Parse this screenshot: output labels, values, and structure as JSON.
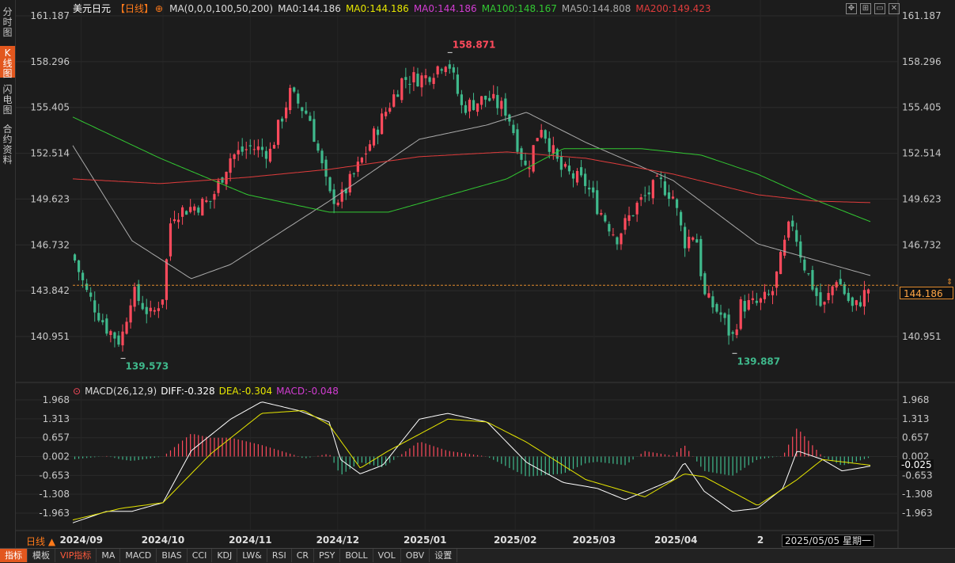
{
  "sidebar": {
    "tabs": [
      {
        "label": "分\n时\n图",
        "active": false
      },
      {
        "label": "K\n线\n图",
        "active": true
      },
      {
        "label": "闪\n电\n图",
        "active": false
      },
      {
        "label": "合\n约\n资\n料",
        "active": false
      }
    ]
  },
  "header": {
    "symbol": "美元日元",
    "period_tag": "【日线】",
    "ma_params": "MA(0,0,0,100,50,200)",
    "ma0_a": "MA0:144.186",
    "ma0_b": "MA0:144.186",
    "ma0_c": "MA0:144.186",
    "ma100": "MA100:148.167",
    "ma50": "MA50:144.808",
    "ma200": "MA200:149.423"
  },
  "macd_header": {
    "params": "MACD(26,12,9)",
    "diff": "DIFF:-0.328",
    "dea": "DEA:-0.304",
    "macd": "MACD:-0.048"
  },
  "price_tag": "144.186",
  "macd_tag": "-0.025",
  "period_button": "日线 ▲",
  "date_box": "2025/05/05 星期一",
  "bottom_tabs": [
    "指标",
    "模板",
    "VIP指标",
    "MA",
    "MACD",
    "BIAS",
    "CCI",
    "KDJ",
    "LW&",
    "RSI",
    "CR",
    "PSY",
    "BOLL",
    "VOL",
    "OBV",
    "设置"
  ],
  "colors": {
    "up": "#ff4a5c",
    "down": "#3fb98c",
    "ma50": "#aaaaaa",
    "ma100": "#32c832",
    "ma200": "#e03c3c",
    "dif": "#ffffff",
    "dea": "#e6e600",
    "accent": "#e2571e"
  },
  "chart_data": [
    {
      "type": "candlestick",
      "title": "美元日元 日线",
      "y_ticks": [
        161.187,
        158.296,
        155.405,
        152.514,
        149.623,
        146.732,
        143.842,
        140.951
      ],
      "ylim": [
        139.0,
        162.0
      ],
      "x_ticks": [
        "2024/09",
        "2024/10",
        "2024/11",
        "2024/12",
        "2025/01",
        "2025/02",
        "2025/03",
        "2025/04",
        "2025/05"
      ],
      "annotations": [
        {
          "label": "158.871",
          "type": "high"
        },
        {
          "label": "139.573",
          "type": "low"
        },
        {
          "label": "139.887",
          "type": "low"
        }
      ],
      "current_price": 144.186,
      "close_path": [
        [
          "2024/08/30",
          146.1
        ],
        [
          "2024/09/04",
          143.7
        ],
        [
          "2024/09/11",
          141.5
        ],
        [
          "2024/09/16",
          140.6
        ],
        [
          "2024/09/20",
          143.8
        ],
        [
          "2024/09/27",
          142.2
        ],
        [
          "2024/10/01",
          143.6
        ],
        [
          "2024/10/04",
          148.7
        ],
        [
          "2024/10/11",
          149.1
        ],
        [
          "2024/10/18",
          149.5
        ],
        [
          "2024/10/25",
          152.3
        ],
        [
          "2024/11/01",
          152.9
        ],
        [
          "2024/11/08",
          152.6
        ],
        [
          "2024/11/15",
          156.3
        ],
        [
          "2024/11/22",
          154.8
        ],
        [
          "2024/11/29",
          149.8
        ],
        [
          "2024/12/03",
          149.6
        ],
        [
          "2024/12/10",
          151.9
        ],
        [
          "2024/12/18",
          154.8
        ],
        [
          "2024/12/25",
          157.2
        ],
        [
          "2025/01/02",
          157.3
        ],
        [
          "2025/01/10",
          158.5
        ],
        [
          "2025/01/15",
          155.4
        ],
        [
          "2025/01/24",
          156.0
        ],
        [
          "2025/01/31",
          155.2
        ],
        [
          "2025/02/07",
          151.4
        ],
        [
          "2025/02/12",
          154.4
        ],
        [
          "2025/02/19",
          151.5
        ],
        [
          "2025/02/28",
          150.6
        ],
        [
          "2025/03/04",
          149.2
        ],
        [
          "2025/03/11",
          147.2
        ],
        [
          "2025/03/18",
          149.2
        ],
        [
          "2025/03/26",
          150.7
        ],
        [
          "2025/03/31",
          149.8
        ],
        [
          "2025/04/04",
          146.9
        ],
        [
          "2025/04/08",
          147.6
        ],
        [
          "2025/04/11",
          143.5
        ],
        [
          "2025/04/17",
          142.3
        ],
        [
          "2025/04/21",
          140.8
        ],
        [
          "2025/04/24",
          142.9
        ],
        [
          "2025/04/30",
          143.0
        ],
        [
          "2025/05/05",
          143.6
        ],
        [
          "2025/05/12",
          148.4
        ],
        [
          "2025/05/16",
          145.7
        ],
        [
          "2025/05/23",
          142.6
        ],
        [
          "2025/05/28",
          144.7
        ],
        [
          "2025/06/03",
          142.6
        ],
        [
          "2025/06/09",
          144.186
        ]
      ],
      "series": [
        {
          "name": "MA50",
          "values_path": [
            [
              "2024/08/30",
              153.0
            ],
            [
              "2024/09/20",
              147.0
            ],
            [
              "2024/10/11",
              144.6
            ],
            [
              "2024/10/25",
              145.5
            ],
            [
              "2024/11/29",
              149.5
            ],
            [
              "2024/12/31",
              153.4
            ],
            [
              "2025/01/24",
              154.3
            ],
            [
              "2025/02/07",
              155.1
            ],
            [
              "2025/02/28",
              153.2
            ],
            [
              "2025/03/31",
              150.8
            ],
            [
              "2025/04/30",
              146.8
            ],
            [
              "2025/05/28",
              145.4
            ],
            [
              "2025/06/09",
              144.8
            ]
          ]
        },
        {
          "name": "MA100",
          "values_path": [
            [
              "2024/08/30",
              154.8
            ],
            [
              "2024/09/30",
              152.2
            ],
            [
              "2024/10/31",
              149.9
            ],
            [
              "2024/11/29",
              148.8
            ],
            [
              "2024/12/20",
              148.8
            ],
            [
              "2025/01/31",
              150.9
            ],
            [
              "2025/02/20",
              152.8
            ],
            [
              "2025/03/20",
              152.8
            ],
            [
              "2025/04/10",
              152.4
            ],
            [
              "2025/04/30",
              151.2
            ],
            [
              "2025/05/20",
              149.6
            ],
            [
              "2025/06/09",
              148.2
            ]
          ]
        },
        {
          "name": "MA200",
          "values_path": [
            [
              "2024/08/30",
              150.9
            ],
            [
              "2024/09/30",
              150.6
            ],
            [
              "2024/10/31",
              151.0
            ],
            [
              "2024/11/29",
              151.5
            ],
            [
              "2024/12/31",
              152.3
            ],
            [
              "2025/01/31",
              152.6
            ],
            [
              "2025/02/28",
              152.2
            ],
            [
              "2025/03/31",
              151.2
            ],
            [
              "2025/04/30",
              149.9
            ],
            [
              "2025/05/20",
              149.5
            ],
            [
              "2025/06/09",
              149.4
            ]
          ]
        }
      ]
    },
    {
      "type": "line",
      "title": "MACD(26,12,9)",
      "y_ticks": [
        1.968,
        1.313,
        0.657,
        0.002,
        -0.653,
        -1.308,
        -1.963
      ],
      "ylim": [
        -2.4,
        2.3
      ],
      "series": [
        {
          "name": "DIFF",
          "values_path": [
            [
              "2024/08/30",
              -2.3
            ],
            [
              "2024/09/11",
              -1.9
            ],
            [
              "2024/09/20",
              -1.9
            ],
            [
              "2024/10/01",
              -1.6
            ],
            [
              "2024/10/11",
              0.2
            ],
            [
              "2024/10/25",
              1.3
            ],
            [
              "2024/11/05",
              1.9
            ],
            [
              "2024/11/18",
              1.6
            ],
            [
              "2024/11/29",
              1.2
            ],
            [
              "2024/12/03",
              -0.1
            ],
            [
              "2024/12/10",
              -0.6
            ],
            [
              "2024/12/18",
              -0.3
            ],
            [
              "2024/12/31",
              1.3
            ],
            [
              "2025/01/10",
              1.5
            ],
            [
              "2025/01/24",
              1.2
            ],
            [
              "2025/02/07",
              -0.2
            ],
            [
              "2025/02/20",
              -0.9
            ],
            [
              "2025/03/04",
              -1.1
            ],
            [
              "2025/03/14",
              -1.5
            ],
            [
              "2025/03/31",
              -0.8
            ],
            [
              "2025/04/04",
              -0.2
            ],
            [
              "2025/04/11",
              -1.2
            ],
            [
              "2025/04/21",
              -1.9
            ],
            [
              "2025/04/30",
              -1.8
            ],
            [
              "2025/05/09",
              -1.1
            ],
            [
              "2025/05/14",
              0.2
            ],
            [
              "2025/05/23",
              -0.1
            ],
            [
              "2025/05/30",
              -0.5
            ],
            [
              "2025/06/09",
              -0.33
            ]
          ]
        },
        {
          "name": "DEA",
          "values_path": [
            [
              "2024/08/30",
              -2.2
            ],
            [
              "2024/09/16",
              -1.8
            ],
            [
              "2024/10/01",
              -1.6
            ],
            [
              "2024/10/18",
              0.1
            ],
            [
              "2024/11/05",
              1.5
            ],
            [
              "2024/11/20",
              1.6
            ],
            [
              "2024/11/29",
              1.1
            ],
            [
              "2024/12/10",
              -0.4
            ],
            [
              "2024/12/20",
              0.2
            ],
            [
              "2025/01/10",
              1.3
            ],
            [
              "2025/01/24",
              1.2
            ],
            [
              "2025/02/07",
              0.5
            ],
            [
              "2025/02/28",
              -0.8
            ],
            [
              "2025/03/21",
              -1.4
            ],
            [
              "2025/04/04",
              -0.6
            ],
            [
              "2025/04/11",
              -0.7
            ],
            [
              "2025/04/30",
              -1.7
            ],
            [
              "2025/05/14",
              -0.8
            ],
            [
              "2025/05/23",
              -0.1
            ],
            [
              "2025/06/09",
              -0.3
            ]
          ]
        },
        {
          "name": "MACD",
          "values_note": "histogram = 2*(DIFF-DEA)"
        }
      ]
    }
  ]
}
